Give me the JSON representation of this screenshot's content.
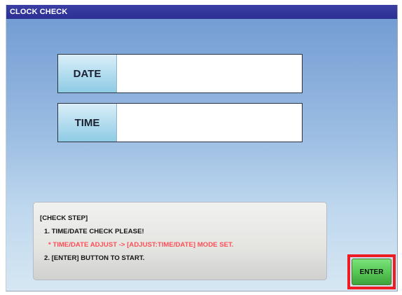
{
  "window": {
    "title": "CLOCK CHECK"
  },
  "fields": {
    "date": {
      "label": "DATE",
      "value": ""
    },
    "time": {
      "label": "TIME",
      "value": ""
    }
  },
  "check_step": {
    "title": "[CHECK STEP]",
    "step_1": "1. TIME/DATE CHECK PLEASE!",
    "note": "* TIME/DATE ADJUST -> [ADJUST:TIME/DATE] MODE SET.",
    "step_2": "2. [ENTER] BUTTON TO START."
  },
  "actions": {
    "enter_label": "ENTER"
  },
  "colors": {
    "title_bar": "#2b2e93",
    "warning_text": "#ff4e55",
    "enter_button": "#58c956",
    "highlight": "#ef1c24"
  }
}
